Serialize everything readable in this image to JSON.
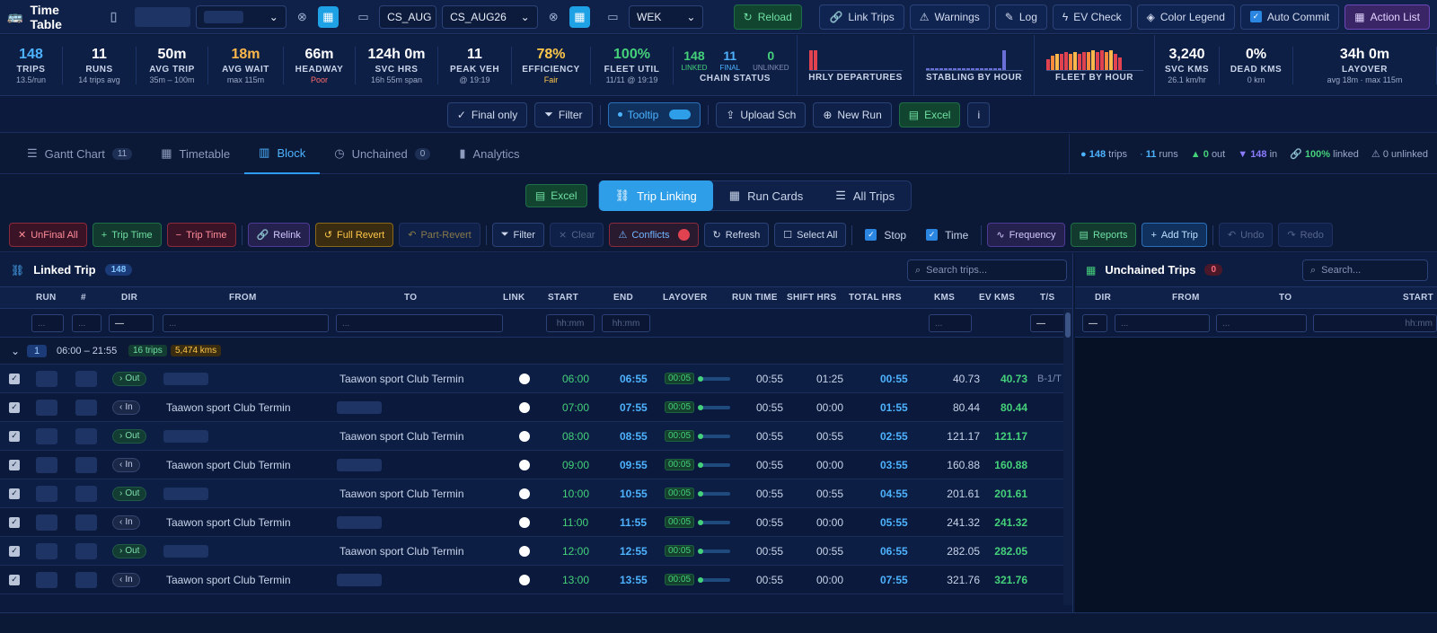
{
  "app": {
    "title": "Time Table"
  },
  "top": {
    "schedule_code": "CS_AUG",
    "schedule_name": "CS_AUG26",
    "day_type": "WEK",
    "reload": "Reload",
    "link_trips": "Link Trips",
    "warnings": "Warnings",
    "log": "Log",
    "ev_check": "EV Check",
    "color_legend": "Color Legend",
    "auto_commit": "Auto Commit",
    "action_list": "Action List"
  },
  "stats": [
    {
      "value": "148",
      "label": "TRIPS",
      "sub": "13.5/run",
      "color": "#4db3ff"
    },
    {
      "value": "11",
      "label": "RUNS",
      "sub": "14 trips avg",
      "color": "#ffffff"
    },
    {
      "value": "50m",
      "label": "AVG TRIP",
      "sub": "35m – 100m",
      "color": "#ffffff"
    },
    {
      "value": "18m",
      "label": "AVG WAIT",
      "sub": "max 115m",
      "color": "#ffb84a"
    },
    {
      "value": "66m",
      "label": "HEADWAY",
      "sub": "Poor",
      "color": "#ffffff",
      "subcolor": "#ff6b6b"
    },
    {
      "value": "124h 0m",
      "label": "SVC HRS",
      "sub": "16h 55m span",
      "color": "#ffffff"
    },
    {
      "value": "11",
      "label": "PEAK VEH",
      "sub": "@ 19:19",
      "color": "#ffffff"
    },
    {
      "value": "78%",
      "label": "EFFICIENCY",
      "sub": "Fair",
      "color": "#ffc84a",
      "subcolor": "#ffc84a"
    },
    {
      "value": "100%",
      "label": "FLEET UTIL",
      "sub": "11/11 @ 19:19",
      "color": "#44d17a"
    }
  ],
  "chain": {
    "linked": "148",
    "linked_l": "LINKED",
    "final": "11",
    "final_l": "FINAL",
    "unlinked": "0",
    "unlinked_l": "UNLINKED",
    "label": "CHAIN STATUS"
  },
  "sparks": {
    "hrly": "HRLY DEPARTURES",
    "stabling": "STABLING BY HOUR",
    "fleet": "FLEET BY HOUR"
  },
  "stats2": [
    {
      "value": "3,240",
      "label": "SVC KMS",
      "sub": "26.1 km/hr"
    },
    {
      "value": "0%",
      "label": "DEAD KMS",
      "sub": "0 km"
    },
    {
      "value": "34h 0m",
      "label": "LAYOVER",
      "sub": "avg 18m · max 115m"
    }
  ],
  "toolbar2": {
    "final_only": "Final only",
    "filter": "Filter",
    "tooltip": "Tooltip",
    "upload": "Upload Sch",
    "new_run": "New Run",
    "excel": "Excel",
    "info": "i"
  },
  "tabs": [
    {
      "label": "Gantt Chart",
      "count": "11"
    },
    {
      "label": "Timetable"
    },
    {
      "label": "Block"
    },
    {
      "label": "Unchained",
      "count": "0"
    },
    {
      "label": "Analytics"
    }
  ],
  "tabinfo": {
    "trips": "148",
    "trips_l": "trips",
    "runs": "11",
    "runs_l": "runs",
    "out": "0",
    "out_l": "out",
    "in": "148",
    "in_l": "in",
    "linked": "100%",
    "linked_l": "linked",
    "unlinked": "0",
    "unlinked_l": "unlinked"
  },
  "mode": {
    "excel": "Excel",
    "trip_linking": "Trip Linking",
    "run_cards": "Run Cards",
    "all_trips": "All Trips"
  },
  "actions": {
    "unfinal": "UnFinal All",
    "trip_time_plus": "Trip Time",
    "trip_time_minus": "Trip Time",
    "relink": "Relink",
    "full_revert": "Full Revert",
    "part_revert": "Part-Revert",
    "filter": "Filter",
    "clear": "Clear",
    "conflicts": "Conflicts",
    "refresh": "Refresh",
    "select_all": "Select All",
    "stop": "Stop",
    "time": "Time",
    "frequency": "Frequency",
    "reports": "Reports",
    "add_trip": "Add Trip",
    "undo": "Undo",
    "redo": "Redo"
  },
  "linked": {
    "title": "Linked Trip",
    "count": "148",
    "search": "Search trips...",
    "cols": [
      "RUN",
      "#",
      "DIR",
      "FROM",
      "TO",
      "LINK",
      "START",
      "END",
      "LAYOVER",
      "RUN TIME",
      "SHIFT HRS",
      "TOTAL HRS",
      "KMS",
      "EV KMS",
      "T/S"
    ],
    "filter_time": "hh:mm",
    "filter_text": "...",
    "filter_dash": "—",
    "group": {
      "run": "1",
      "span": "06:00 – 21:55",
      "trips": "16 trips",
      "kms": "5,474 kms"
    },
    "rows": [
      {
        "dir": "Out",
        "from": "",
        "to": "Taawon sport Club Termin",
        "start": "06:00",
        "end": "06:55",
        "layover": "00:05",
        "run_time": "00:55",
        "shift": "01:25",
        "total": "00:55",
        "kms": "40.73",
        "ev": "40.73",
        "ts": "B-1/T"
      },
      {
        "dir": "In",
        "from": "Taawon sport Club Termin",
        "to": "",
        "start": "07:00",
        "end": "07:55",
        "layover": "00:05",
        "run_time": "00:55",
        "shift": "00:00",
        "total": "01:55",
        "kms": "80.44",
        "ev": "80.44",
        "ts": ""
      },
      {
        "dir": "Out",
        "from": "",
        "to": "Taawon sport Club Termin",
        "start": "08:00",
        "end": "08:55",
        "layover": "00:05",
        "run_time": "00:55",
        "shift": "00:55",
        "total": "02:55",
        "kms": "121.17",
        "ev": "121.17",
        "ts": ""
      },
      {
        "dir": "In",
        "from": "Taawon sport Club Termin",
        "to": "",
        "start": "09:00",
        "end": "09:55",
        "layover": "00:05",
        "run_time": "00:55",
        "shift": "00:00",
        "total": "03:55",
        "kms": "160.88",
        "ev": "160.88",
        "ts": ""
      },
      {
        "dir": "Out",
        "from": "",
        "to": "Taawon sport Club Termin",
        "start": "10:00",
        "end": "10:55",
        "layover": "00:05",
        "run_time": "00:55",
        "shift": "00:55",
        "total": "04:55",
        "kms": "201.61",
        "ev": "201.61",
        "ts": ""
      },
      {
        "dir": "In",
        "from": "Taawon sport Club Termin",
        "to": "",
        "start": "11:00",
        "end": "11:55",
        "layover": "00:05",
        "run_time": "00:55",
        "shift": "00:00",
        "total": "05:55",
        "kms": "241.32",
        "ev": "241.32",
        "ts": ""
      },
      {
        "dir": "Out",
        "from": "",
        "to": "Taawon sport Club Termin",
        "start": "12:00",
        "end": "12:55",
        "layover": "00:05",
        "run_time": "00:55",
        "shift": "00:55",
        "total": "06:55",
        "kms": "282.05",
        "ev": "282.05",
        "ts": ""
      },
      {
        "dir": "In",
        "from": "Taawon sport Club Termin",
        "to": "",
        "start": "13:00",
        "end": "13:55",
        "layover": "00:05",
        "run_time": "00:55",
        "shift": "00:00",
        "total": "07:55",
        "kms": "321.76",
        "ev": "321.76",
        "ts": ""
      }
    ]
  },
  "unchained": {
    "title": "Unchained Trips",
    "count": "0",
    "search": "Search...",
    "cols": [
      "DIR",
      "FROM",
      "TO",
      "START"
    ]
  }
}
